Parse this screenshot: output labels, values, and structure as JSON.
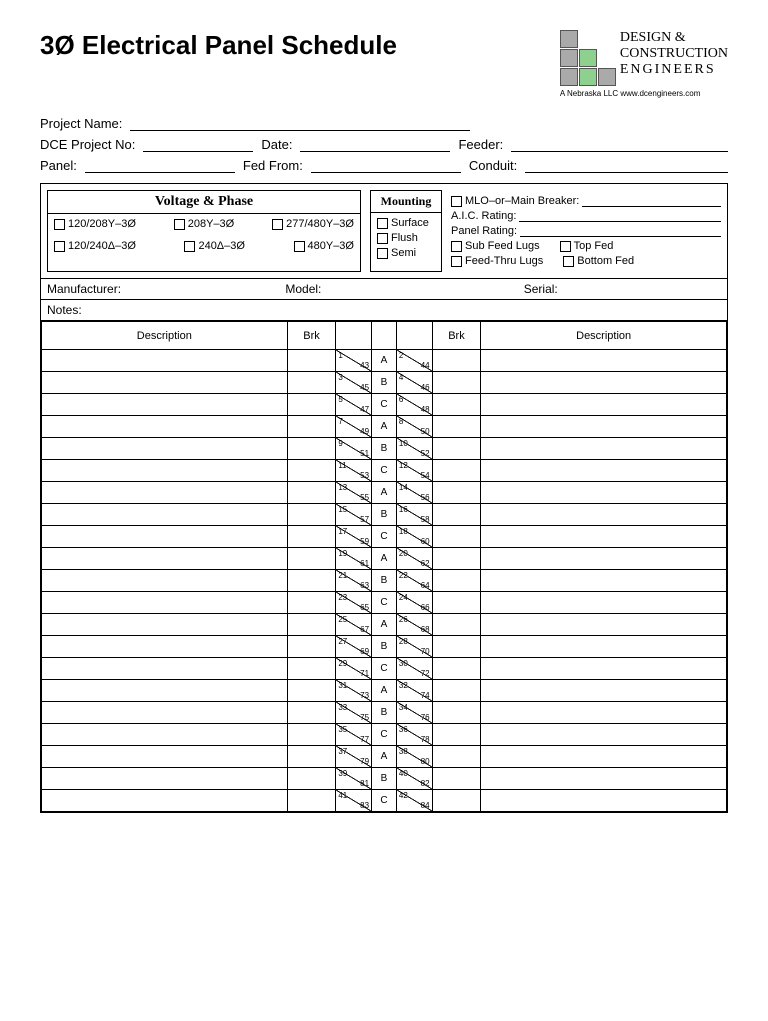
{
  "title": "3Ø Electrical Panel Schedule",
  "logo": {
    "l1": "DESIGN &",
    "l2": "CONSTRUCTION",
    "l3": "ENGINEERS",
    "sub": "A Nebraska LLC   www.dcengineers.com"
  },
  "fields": {
    "project": "Project Name:",
    "dceno": "DCE Project No:",
    "date": "Date:",
    "feeder": "Feeder:",
    "panel": "Panel:",
    "fedfrom": "Fed From:",
    "conduit": "Conduit:"
  },
  "vp": {
    "h": "Voltage & Phase",
    "opts": [
      "120/208Y–3Ø",
      "208Y–3Ø",
      "277/480Y–3Ø",
      "120/240Δ–3Ø",
      "240Δ–3Ø",
      "480Y–3Ø"
    ]
  },
  "mt": {
    "h": "Mounting",
    "opts": [
      "Surface",
      "Flush",
      "Semi"
    ]
  },
  "ro": {
    "mlo": "MLO–or–Main Breaker:",
    "aic": "A.I.C. Rating:",
    "pr": "Panel Rating:",
    "cbs": [
      "Sub Feed Lugs",
      "Top Fed",
      "Feed-Thru Lugs",
      "Bottom Fed"
    ]
  },
  "meta": {
    "mfr": "Manufacturer:",
    "model": "Model:",
    "serial": "Serial:",
    "notes": "Notes:"
  },
  "cols": {
    "desc": "Description",
    "brk": "Brk"
  },
  "phases": [
    "A",
    "B",
    "C"
  ],
  "rows": 21
}
